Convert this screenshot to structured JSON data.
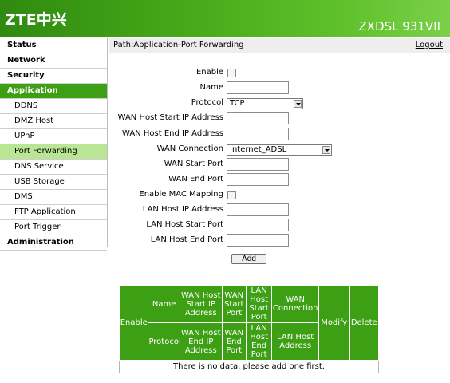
{
  "header": {
    "logo": "ZTE中兴",
    "model": "ZXDSL 931VII"
  },
  "sidebar": {
    "items": [
      {
        "label": "Status"
      },
      {
        "label": "Network"
      },
      {
        "label": "Security"
      },
      {
        "label": "Application"
      },
      {
        "label": "DDNS"
      },
      {
        "label": "DMZ Host"
      },
      {
        "label": "UPnP"
      },
      {
        "label": "Port Forwarding"
      },
      {
        "label": "DNS Service"
      },
      {
        "label": "USB Storage"
      },
      {
        "label": "DMS"
      },
      {
        "label": "FTP Application"
      },
      {
        "label": "Port Trigger"
      },
      {
        "label": "Administration"
      }
    ]
  },
  "pathbar": {
    "path": "Path:Application-Port Forwarding",
    "logout": "Logout"
  },
  "form": {
    "enable_label": "Enable",
    "name_label": "Name",
    "name_value": "",
    "protocol_label": "Protocol",
    "protocol_value": "TCP",
    "wan_host_start_label": "WAN Host Start IP Address",
    "wan_host_end_label": "WAN Host End IP Address",
    "wan_connection_label": "WAN Connection",
    "wan_connection_value": "Internet_ADSL",
    "wan_start_port_label": "WAN Start Port",
    "wan_end_port_label": "WAN End Port",
    "enable_mac_label": "Enable MAC Mapping",
    "lan_host_ip_label": "LAN Host IP Address",
    "lan_host_start_port_label": "LAN Host Start Port",
    "lan_host_end_port_label": "LAN Host End Port",
    "add_label": "Add"
  },
  "table": {
    "enable": "Enable",
    "name": "Name",
    "wan_host_start_ip": "WAN Host Start IP Address",
    "wan_start_port": "WAN Start Port",
    "lan_host_start_port": "LAN Host Start Port",
    "wan_connection": "WAN Connection",
    "modify": "Modify",
    "delete": "Delete",
    "protocol": "Protocol",
    "wan_host_end_ip": "WAN Host End IP Address",
    "wan_end_port": "WAN End Port",
    "lan_host_end_port": "LAN Host End Port",
    "lan_host_address": "LAN Host Address",
    "empty_message": "There is no data, please add one first."
  },
  "colors": {
    "brand_green": "#3d9f14",
    "selected_item": "#b8e694"
  }
}
